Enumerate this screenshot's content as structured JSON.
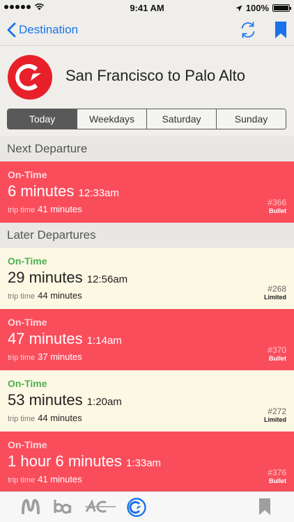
{
  "status_bar": {
    "time": "9:41 AM",
    "battery": "100%",
    "battery_level": 1.0
  },
  "nav": {
    "back_label": "Destination",
    "icons": [
      "chevron-left-icon",
      "refresh-icon",
      "bookmark-icon"
    ]
  },
  "header": {
    "route": "San Francisco to Palo Alto",
    "logo_icon": "caltrain-logo-icon"
  },
  "segments": [
    {
      "label": "Today",
      "active": true
    },
    {
      "label": "Weekdays",
      "active": false
    },
    {
      "label": "Saturday",
      "active": false
    },
    {
      "label": "Sunday",
      "active": false
    }
  ],
  "sections": {
    "next": "Next Departure",
    "later": "Later Departures"
  },
  "trip_time_label": "trip time",
  "departures": [
    {
      "status": "On-Time",
      "eta": "6 minutes",
      "clock": "12:33am",
      "trip": "41 minutes",
      "train": "#366",
      "type": "Bullet",
      "color": "#fa4d5c"
    },
    {
      "status": "On-Time",
      "eta": "29 minutes",
      "clock": "12:56am",
      "trip": "44 minutes",
      "train": "#268",
      "type": "Limited",
      "color": "#fcf8e3"
    },
    {
      "status": "On-Time",
      "eta": "47 minutes",
      "clock": "1:14am",
      "trip": "37 minutes",
      "train": "#370",
      "type": "Bullet",
      "color": "#fa4d5c"
    },
    {
      "status": "On-Time",
      "eta": "53 minutes",
      "clock": "1:20am",
      "trip": "44 minutes",
      "train": "#272",
      "type": "Limited",
      "color": "#fcf8e3"
    },
    {
      "status": "On-Time",
      "eta": "1 hour 6 minutes",
      "clock": "1:33am",
      "trip": "41 minutes",
      "train": "#376",
      "type": "Bullet",
      "color": "#fa4d5c"
    }
  ],
  "tab_bar": {
    "icons": [
      "muni-icon",
      "bart-icon",
      "ac-transit-icon",
      "caltrain-icon",
      "bookmark-icon"
    ],
    "active": "caltrain-icon"
  },
  "colors": {
    "accent": "#1a73e8",
    "bullet": "#fa4d5c",
    "limited": "#fcf8e3",
    "on_time_green": "#4caf50"
  }
}
